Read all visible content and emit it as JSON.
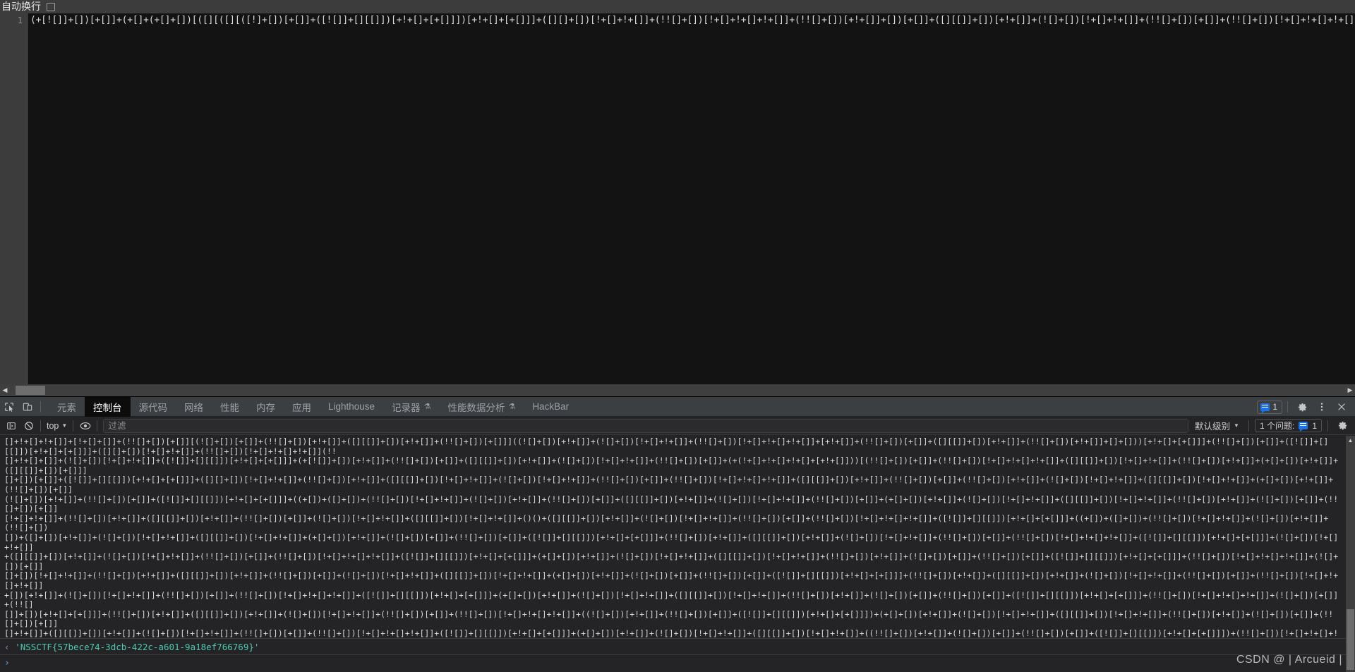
{
  "page": {
    "wrap_label": "自动换行",
    "line_number": "1",
    "code": "(+[![]]+[])[+[]]+(+[]+(+[]+[])[([][([][([!]+[])[+[]]+([![]]+[][[]])[+!+[]+[+[]]])[+!+[]+[+[]]]+([][]+[])[!+[]+!+[]]+(!![]+[])[!+[]+!+[]+!+[]]+(!![]+[])[+!+[]]+[])[+[]]+([][[]]+[])[+!+[]]+(![]+[])[!+[]+!+[]]+(!![]+[])[+[]]+(!![]+[])[!+[]+!+[]+!+[]]+(!![]+[])[+!+[]]]+[])[!+[]+!+[]+!+[]]+(!![]+[])[+!+[]]+(![]+[])[!+[]+!+[]]+(!![]+[])[+[]]+(!![]+[])[!+[]+!+[]+!+[]]+(!![]+[])[+!+[]]+[+!+[]+[+[]"
  },
  "tabbar": {
    "icons": [
      {
        "name": "inspect-element-icon"
      },
      {
        "name": "device-toolbar-icon"
      }
    ],
    "tabs": [
      {
        "label": "元素",
        "active": false,
        "flask": false
      },
      {
        "label": "控制台",
        "active": true,
        "flask": false
      },
      {
        "label": "源代码",
        "active": false,
        "flask": false
      },
      {
        "label": "网络",
        "active": false,
        "flask": false
      },
      {
        "label": "性能",
        "active": false,
        "flask": false
      },
      {
        "label": "内存",
        "active": false,
        "flask": false
      },
      {
        "label": "应用",
        "active": false,
        "flask": false
      },
      {
        "label": "Lighthouse",
        "active": false,
        "flask": false
      },
      {
        "label": "记录器",
        "active": false,
        "flask": true
      },
      {
        "label": "性能数据分析",
        "active": false,
        "flask": true
      },
      {
        "label": "HackBar",
        "active": false,
        "flask": false
      }
    ],
    "issue_count": "1",
    "settings_label": "设置",
    "more_label": "更多选项",
    "close_label": "关闭"
  },
  "filterbar": {
    "sidebar_toggle": "控制台边栏",
    "clear_label": "清除控制台",
    "context": "top",
    "eye_label": "实时表达式",
    "filter_value": "",
    "filter_placeholder": "过滤",
    "level": "默认级别",
    "issues_text": "1 个问题:",
    "issues_count": "1",
    "settings_label": "控制台设置"
  },
  "console": {
    "message": "[]+!+[]+!+[]]+[!+[]+[]]+(!![]+[])[+[]][(![]+[])[+[]]+(!![]+[])[+!+[]]+([][[]]+[])[+!+[]]+(!![]+[])[+[]]]((![]+[])[+!+[]]+(![]+[])[!+[]+!+[]]+(!![]+[])[!+[]+!+[]+!+[]]+[+!+[]]+(!![]+[])[+[]]+([][[]]+[])[+!+[]]+(!![]+[])[+!+[]]+[]+[]))[+!+[]+[+[]]]+(!![]+[])[+[]]+([![]]+[][[]])[+!+[]+[+[]]]+([][]+[])[!+[]+!+[]]+(!![]+[])[!+[]+!+[]+!+[]](!!\n[]+!+[]+[]]+(![]+[])[!+[]+!+[]]+([![]]+[][[]])[+!+[]+[+[]]]+(+[![]]+[])[+!+[]]+(!![]+[])[+[]]+([][[]]+[])[+!+[]]+(![]+[])[!+[]+!+[]]+(!![]+[])[+[]]+(+(!+[]+!+[]+!+[]+[+!+[]]))[(!![]+[])[+[]]+(!![]+[])[!+[]+!+[]+!+[]]+([][[]]+[])[!+[]+!+[]]+(!![]+[])[+!+[]]+(+[]+[])[+!+[]]+([][[]]+[])[+[]]]\n[]+[])[+[]]+([![]]+[][[]])[+!+[]+[+[]]]+([][]+[])[!+[]+!+[]]+(!![]+[])[+!+[]]+([][[]]+[])[!+[]+!+[]]+(![]+[])[!+[]+!+[]]+(!![]+[])[+[]]+(!![]+[])[!+[]+!+[]+!+[]]+([][[]]+[])[+!+[]]+(!![]+[])[+[]]+(!![]+[])[+!+[]]+(![]+[])[!+[]+!+[]]+([][[]]+[])[!+[]+!+[]]+(+[]+[])[+!+[]]+(!![]+[])[+[]]\n(![]+[])[+!+[]]+(!![]+[])[+[]]+([![]]+[][[]])[+!+[]+[+[]]]+((+[])+([]+[])+(!![]+[])[!+[]+!+[]]+(![]+[])[+!+[]]+(!![]+[])[+[]]+([][[]]+[])[+!+[]]+(![]+[])[!+[]+!+[]]+(!![]+[])[+[]]+(+[]+[])[+!+[]]+(![]+[])[!+[]+!+[]]+([][[]]+[])[!+[]+!+[]]+(!![]+[])[+!+[]]+(![]+[])[+[]]+(!![]+[])[+[]]\n[!+[]+!+[]]+(!![]+[])[+!+[]]+([][[]]+[])[+!+[]]+(!![]+[])[+[]]+(![]+[])[!+[]+!+[]]+([][[]]+[])[!+[]+!+[]]+()()+([][[]]+[])[+!+[]]+(![]+[])[!+[]+!+[]]+(!![]+[])[+[]]+(!![]+[])[!+[]+!+[]+!+[]]+([![]]+[][[]])[+!+[]+[+[]]]+((+[])+([]+[])+(!![]+[])[!+[]+!+[]]+(![]+[])[+!+[]]+(!![]+[])\n[])+([]+[])[+!+[]]+(![]+[])[!+[]+!+[]]+([][[]]+[])[!+[]+!+[]]+(+[]+[])[+!+[]]+(![]+[])[+[]]+(!![]+[])[+[]]+([![]]+[][[]])[+!+[]+[+[]]]+(!![]+[])[+!+[]]+([][[]]+[])[+!+[]]+(![]+[])[!+[]+!+[]]+(!![]+[])[+[]]+(!![]+[])[!+[]+!+[]+!+[]]+([![]]+[][[]])[+!+[]+[+[]]]+(![]+[])[!+[]+!+[]]\n+([][[]]+[])[+!+[]]+(![]+[])[!+[]+!+[]]+(!![]+[])[+[]]+(!![]+[])[!+[]+!+[]+!+[]]+([![]]+[][[]])[+!+[]+[+[]]]+(+[]+[])[+!+[]]+(![]+[])[!+[]+!+[]]+([][[]]+[])[!+[]+!+[]]+(!![]+[])[+!+[]]+(![]+[])[+[]]+(!![]+[])[+[]]+([![]]+[][[]])[+!+[]+[+[]]]+(!![]+[])[!+[]+!+[]+!+[]]+(![]+[])[+[]]\n[]+[])[!+[]+!+[]]+(!![]+[])[+!+[]]+([][[]]+[])[+!+[]]+(!![]+[])[+[]]+(![]+[])[!+[]+!+[]]+([][[]]+[])[!+[]+!+[]]+(+[]+[])[+!+[]]+(![]+[])[+[]]+(!![]+[])[+[]]+([![]]+[][[]])[+!+[]+[+[]]]+(!![]+[])[+!+[]]+([][[]]+[])[+!+[]]+(![]+[])[!+[]+!+[]]+(!![]+[])[+[]]+(!![]+[])[!+[]+!+[]+!+[]]\n+[])[+!+[]]+(![]+[])[!+[]+!+[]]+(!![]+[])[+[]]+(!![]+[])[!+[]+!+[]+!+[]]+([![]]+[][[]])[+!+[]+[+[]]]+(+[]+[])[+!+[]]+(![]+[])[!+[]+!+[]]+([][[]]+[])[!+[]+!+[]]+(!![]+[])[+!+[]]+(![]+[])[+[]]+(!![]+[])[+[]]+([![]]+[][[]])[+!+[]+[+[]]]+(!![]+[])[!+[]+!+[]+!+[]]+(![]+[])[+[]]+(!![]\n[]]+[])[+!+[]+[+[]]]+(!![]+[])[+!+[]]+([][[]]+[])[+!+[]]+(![]+[])[!+[]+!+[]]+(!![]+[])[+[]]+(!![]+[])[!+[]+!+[]+!+[]]+((![]+[])[+!+[]]+(!![]+[])[+[]]+([![]]+[][[]])[+!+[]+[+[]]])+(+[]+[])[+!+[]]+(![]+[])[!+[]+!+[]]+([][[]]+[])[!+[]+!+[]]+(!![]+[])[+!+[]]+(![]+[])[+[]]+(!![]+[])[+[]]\n[]+!+[]]+([][[]]+[])[+!+[]]+(![]+[])[!+[]+!+[]]+(!![]+[])[+[]]+(!![]+[])[!+[]+!+[]+!+[]]+([![]]+[][[]])[+!+[]+[+[]]]+(+[]+[])[+!+[]]+(![]+[])[!+[]+!+[]]+([][[]]+[])[!+[]+!+[]]+((!![]+[])[+!+[]]+(![]+[])[+[]]+(!![]+[])[+[]]+([![]]+[][[]])[+!+[]+[+[]]])+(!![]+[])[!+[]+!+[]+!+[]]+(![]\n+[])[!+[]+!+[]]+([][[]]+[])[+!+[]]+(![]+[])[!+[]+!+[]]+(!![]+[])[+[]]+(!![]+[])[!+[]+!+[]+!+[]]+([![]]+[][[]])[+!+[]+[+[]]]+(+[]+[])[+!+[]]+(![]+[])[!+[]+!+[]]+([][[]]+[])[!+[]+!+[]]+(!![]+[])[+!+[]]+(![]+[])[+[]]+(!![]+[])[+[]]+([![]]+[][[]])[+!+[]+[+[]]]+(!![]+[])[!+[]+!+[]+!+[]]\n+[])[+!+[]]+(![]+[])[!+[]+!+[]]+(!![]+[])[+[]]+(!![]+[])[!+[]+!+[]+!+[]]+([![]]+[][[]])[+!+[]+[+[]]]+(+[]+[])[+!+[]]+((![]+[])[!+[]+!+[]]+([][[]]+[])[!+[]+!+[]]+(!![]+[])[+!+[]]+(![]+[])[+[]]+(!![]+[])[+[]])+([![]]+[][[]])[+!+[]+[+[]]]+(!![]+[])[!+[]+!+[]+!+[]]+(![]+[])[+[]]+(!![]\n[]+[])[!+[]+!+[]]+([][[]]+[])[+!+[]]+(![]+[])[!+[]+!+[]]+(!![]+[])[+[]]+(!![]+[])[!+[]+!+[]+!+[]]+([![]]+[][[]])[+!+[]+[+[]]]+(+[]+[])[+!+[]]+(![]+[])[!+[]+!+[]]+([][[]]+[])[!+[]+!+[]]+(!![]+[])[+!+[]]+(![]+[])[+[]]+(!![]+[])[+[]]+([![]]+[][[]])[+!+[]+[+[]]]+(!![]+[])[!+[]+!+[]+!+[]]\n+[]]+(![]+[])[!+[]+!+[]]+([][[]]+[])[+!+[]]+(![]+[])[!+[]+!+[]]+(!![]+[])[+[]]+(!![]+[])[!+[]+!+[]+!+[]]+([![]]+[][[]])[+!+[]+[+[]]]+((+[]+[])[+!+[]]+(![]+[])[!+[]+!+[]]+([][[]]+[])[!+[]+!+[]])+(!![]+[])[+!+[]]+(![]+[])[+[]]+(!![]+[])[+[]]+([![]]+[][[]])[+!+[]+[+[]]]+(!![]+[])[!+[]\n+!+[]+!+[]]+(![]+[])[+[]]+(!![]+[])[+[]]+([![]]+[][[]])[+!+[]+[+[]]]+(!![]+[])[+!+[]]+([][[]]+[])[+!+[]]+(![]+[])[!+[]+!+[]]+(!![]+[])[+[]]+(!![]+[])[!+[]+!+[]+!+[]]+([![]]+[][[]])[+!+[]+[+[]]]+(+[]+[])[+!+[]]+(![]+[])[!+[]+!+[]]+([][[]]+[])[!+[]+!+[]]+(!![]+[])[+!+[]]+(![]+[])[+[]]\n[]+[])[+!+[]]+(![]+[])[!+[]+!+[]]+([][[]]+[])[!+[]+!+[]]+(!![]+[])[+!+[]]+(![]+[])[+[]]+(!![]+[])[+[]]+([![]]+[][[]])[+!+[]+[+[]]]+(!![]+[])[!+[]+!+[]+!+[]]+(![]+[])[+[]]+(!![]+[])[+[]]+([![]]+[][[]])[+!+[]+[+[]]]+(!![]+[])[+!+[]]+([][[]]+[])[+!+[]]+(![]+[])[!+[]+!+[]]+(!![]+[])[+[]]\n+!+[]]+(!![]+[])[+[]]+([![]]+[][[]])[+!+[]+[+[]]]+(!![]+[])[!+[]+!+[]+!+[]]+(![]+[])[+[]]+(!![]+[])[+[]]+([![]]+[][[]])[+!+[]+[+[]]]+(!![]+[])[+!+[]]+([][[]]+[])[+!+[]]+(![]+[])[!+[]+!+[]]+(!![]+[])[+[]]+(!![]+[])[!+[]+!+[]+!+[]]+([![]]+[][[]])[+!+[]+[+[]]]+(+[]+[])[+!+[]]+(![]+[])\n[!+[]+!+[]]+([][[]]+[])[!+[]+!+[]]+(!![]+[])[+!+[]]+(![]+[])[+[]]+(!![]+[])[+[]]+([![]]+[][[]])[+!+[]+[+[]]]+(!![]+[])[!+[]+!+[]+!+[]]+(![]+[])[+[]]+(!![]+[])[+[]]+([![]]+[][[]])[+!+[]+[+[]]]+(!![]+[])[+!+[]]+([][[]]+[])[+!+[]]+(![]+[])[!+[]+!+[]]+(!![]+[])[+[]]+(!![]+[])[!+[]+!+[]]\n+[])[+[]]+(!![]+[])[+[]]+([![]]+[][[]])[+!+[]+[+[]]]+(!![]+[])[!+[]+!+[]+!+[]]+(![]+[])[+[]]+(!![]+[])[+[]]+([![]]+[][[]])[+!+[]+[+[]]]+(((+[]+[])[+!+[]]+(![]+[])[!+[]+!+[]]+([][[]]+[])[!+[]+!+[]])+(!![]+[])[+!+[]]+(![]+[])[+[]]+(!![]+[])[+[]])+([![]]+[][[]])[+!+[]+[+[]]]+(!![]+[])\n[!+[]+!+[]+!+[]]+(![]+[])[+[]]+(!![]+[])[+[]]+([![]]+[][[]])[+!+[]+[+[]]]+(!![]+[])[+!+[]]+([][[]]+[])[+!+[]]+(![]+[])[!+[]+!+[]]+(!![]+[])[+[]]+(!![]+[])[!+[]+!+[]+!+[]]+([![]]+[][[]])[+!+[]+[+[]]]+(+[]+[])[+!+[]]+(![]+[])[!+[]+!+[]]+([][[]]+[])[!+[]+!+[]]+(!![]+[])[+!+[]]+(![]+[])\n[+[]]+(!![]+[])[+[]]+([![]]+[][[]])[+!+[]+[+[]]]+(!![]+[])[!+[]+!+[]+!+[]]+(![]+[])[+[]]+(!![]+[])[+[]]+([![]]+[][[]])[+!+[]+[+[]]]+(!![]+[])[+!+[]]+([][[]]+[])[+!+[]]+(![]+[])[!+[]+!+[]]+(!![]+[])[+[]]+(!![]+[])[!+[]+!+[]+!+[]]+(((+[]+[])[+!+[]]+(![]+[])[!+[]+!+[]])+([][[]]+[])[!]\n+[]]+(!![]+[])[+!+[]]+(![]+[])[+[]]+(!![]+[])[+[]]+([![]]+[][[]])[+!+[]+[+[]]]+(!![]+[])[!+[]+!+[]+!+[]]+(![]+[])[+[]]+(!![]+[])[+[]]+([![]]+[][[]])[+!+[]+[+[]]]+(!![]+[])[+!+[]]+([][[]]+[])[+!+[]]+(![]+[])[!+[]+!+[]]+(!![]+[])[+[]]+(!![]+[])[!+[]+!+[]+!+[]]+([![]]+[][[]])[+!+[]+[])",
    "return_arrow": "‹",
    "result": "'NSSCTF{57bece74-3dcb-422c-a601-9a18ef766769}'",
    "prompt": "›"
  },
  "watermark": "CSDN @ | Arcueid |",
  "colors": {
    "accent_blue": "#1a73e8",
    "result_teal": "#4ec9b0",
    "tab_active_bg": "#0c0c0c",
    "devtools_bg": "#242427",
    "page_bg": "#3c3c3c",
    "editor_bg": "#131313"
  }
}
